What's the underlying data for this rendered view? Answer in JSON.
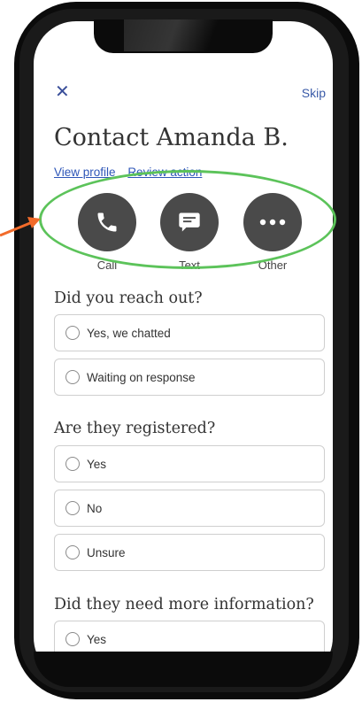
{
  "header": {
    "close_glyph": "✕",
    "skip_label": "Skip"
  },
  "title": "Contact Amanda B.",
  "links": {
    "view_profile": "View profile",
    "review_action": "Review action"
  },
  "actions": [
    {
      "label": "Call",
      "icon": "phone-icon"
    },
    {
      "label": "Text",
      "icon": "chat-icon"
    },
    {
      "label": "Other",
      "icon": "more-icon"
    }
  ],
  "questions": [
    {
      "text": "Did you reach out?",
      "options": [
        "Yes, we chatted",
        "Waiting on response"
      ]
    },
    {
      "text": "Are they registered?",
      "options": [
        "Yes",
        "No",
        "Unsure"
      ]
    },
    {
      "text": "Did they need more information?",
      "options": [
        "Yes"
      ]
    }
  ],
  "colors": {
    "accent": "#3a5ba8",
    "highlight_ring": "#5cc35a",
    "arrow": "#f26b2a",
    "button_bg": "#4a4a4a"
  }
}
